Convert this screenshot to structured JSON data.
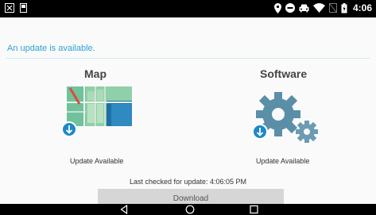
{
  "status_bar": {
    "time": "4:06",
    "left_icons": [
      "close-box-icon",
      "sd-card-icon"
    ],
    "right_icons": [
      "location-icon",
      "do-not-disturb-icon",
      "car-icon",
      "wifi-icon",
      "no-sim-icon",
      "battery-icon"
    ]
  },
  "main": {
    "update_message": "An update is available.",
    "map": {
      "title": "Map",
      "status": "Update Available",
      "icon": "map-update-icon"
    },
    "software": {
      "title": "Software",
      "status": "Update Available",
      "icon": "gears-update-icon"
    },
    "last_checked": "Last checked for update: 4:06:05 PM",
    "download_label": "Download"
  },
  "nav_bar": {
    "buttons": [
      "back-icon",
      "home-icon",
      "recents-icon"
    ]
  },
  "colors": {
    "accent": "#2aa3d0",
    "button_bg": "#d6d6d6",
    "download_badge": "#1e88c8",
    "gear": "#5a8fa7"
  }
}
